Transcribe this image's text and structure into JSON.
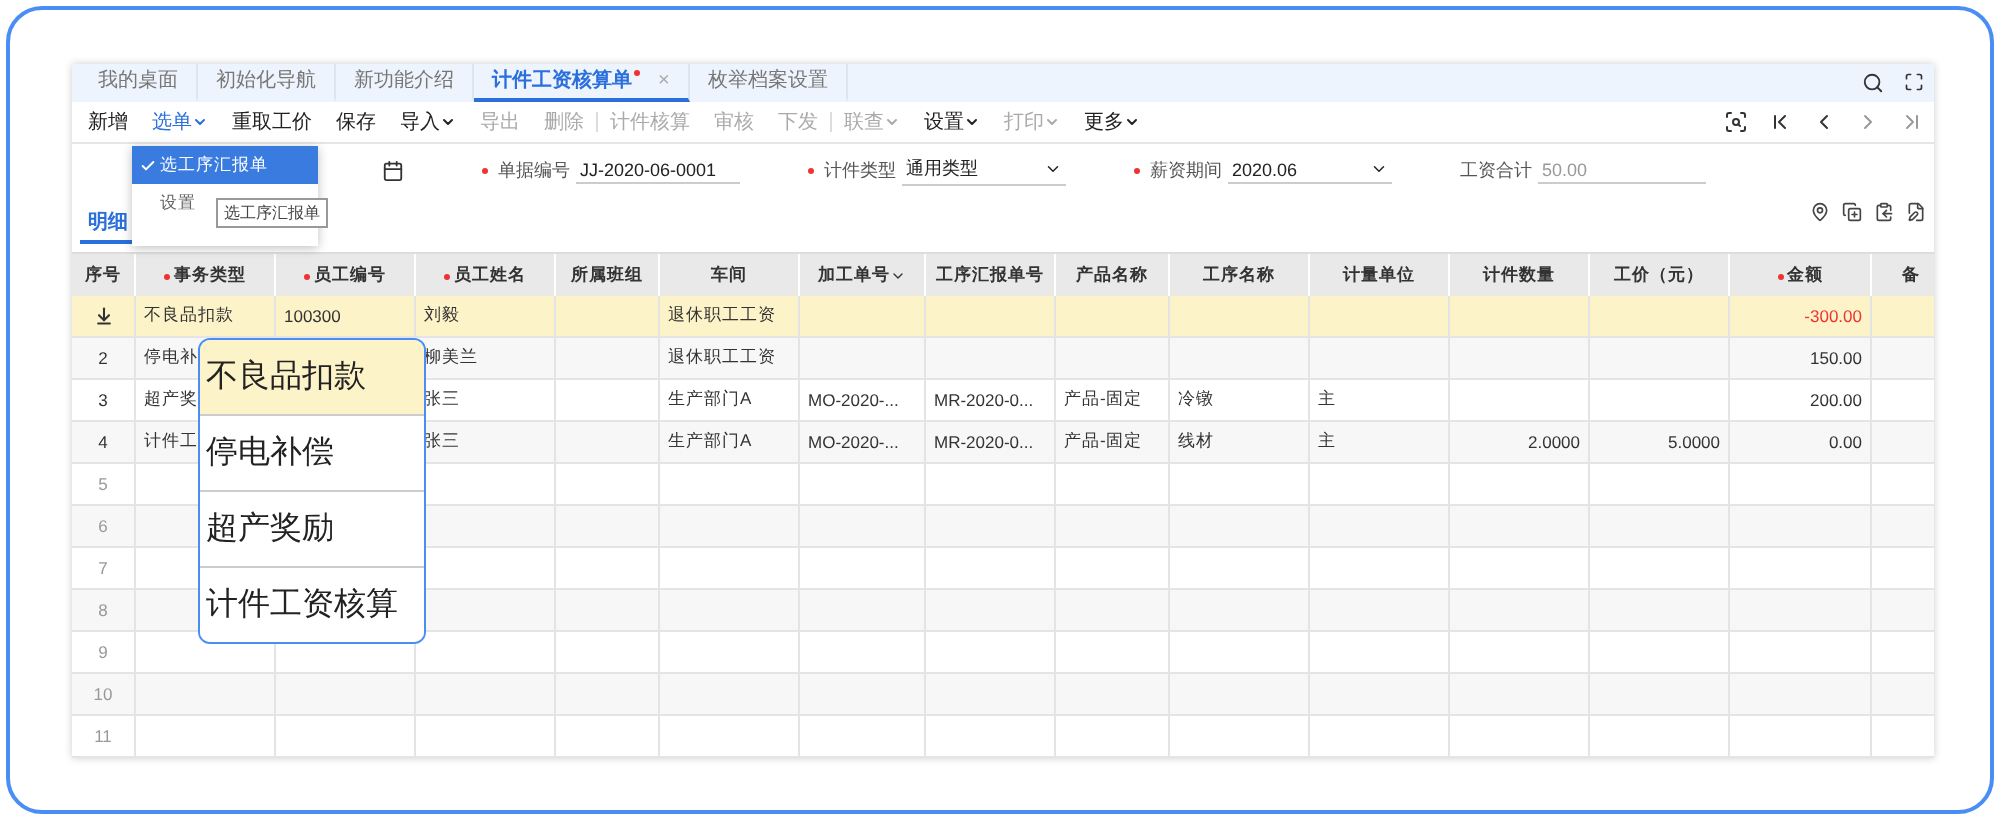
{
  "tabs": [
    {
      "label": "我的桌面",
      "selected": false,
      "unsaved": false
    },
    {
      "label": "初始化导航",
      "selected": false,
      "unsaved": false
    },
    {
      "label": "新功能介绍",
      "selected": false,
      "unsaved": false
    },
    {
      "label": "计件工资核算单",
      "selected": true,
      "unsaved": true,
      "close": "×"
    },
    {
      "label": "枚举档案设置",
      "selected": false,
      "unsaved": false
    }
  ],
  "toolbar": [
    {
      "label": "新增",
      "disabled": false,
      "dropdown": false
    },
    {
      "label": "选单",
      "disabled": false,
      "dropdown": true,
      "active": true
    },
    {
      "label": "重取工价",
      "disabled": false,
      "dropdown": false
    },
    {
      "label": "保存",
      "disabled": false,
      "dropdown": false
    },
    {
      "label": "导入",
      "disabled": false,
      "dropdown": true
    },
    {
      "label": "导出",
      "disabled": true,
      "dropdown": false
    },
    {
      "label": "删除",
      "disabled": true,
      "dropdown": false
    },
    {
      "label": "计件核算",
      "disabled": true,
      "dropdown": false,
      "divider_before": true
    },
    {
      "label": "审核",
      "disabled": true,
      "dropdown": false
    },
    {
      "label": "下发",
      "disabled": true,
      "dropdown": false
    },
    {
      "label": "联查",
      "disabled": true,
      "dropdown": true,
      "divider_before": true
    },
    {
      "label": "设置",
      "disabled": false,
      "dropdown": true
    },
    {
      "label": "打印",
      "disabled": true,
      "dropdown": true
    },
    {
      "label": "更多",
      "disabled": false,
      "dropdown": true
    }
  ],
  "select_menu": {
    "items": [
      {
        "label": "选工序汇报单",
        "checked": true
      },
      {
        "label": "设置",
        "checked": false
      }
    ],
    "tooltip": "选工序汇报单"
  },
  "form": [
    {
      "kind": "date"
    },
    {
      "kind": "text",
      "label": "单据编号",
      "required": true,
      "value": "JJ-2020-06-0001"
    },
    {
      "kind": "select",
      "label": "计件类型",
      "required": true,
      "value": "通用类型"
    },
    {
      "kind": "select",
      "label": "薪资期间",
      "required": true,
      "value": "2020.06"
    },
    {
      "kind": "readonly",
      "label": "工资合计",
      "value": "50.00"
    }
  ],
  "detail_tab": {
    "label": "明细",
    "selected": true
  },
  "table": {
    "columns": [
      {
        "label": "序号",
        "required": false
      },
      {
        "label": "事务类型",
        "required": true
      },
      {
        "label": "员工编号",
        "required": true
      },
      {
        "label": "员工姓名",
        "required": true
      },
      {
        "label": "所属班组",
        "required": false
      },
      {
        "label": "车间",
        "required": false
      },
      {
        "label": "加工单号",
        "required": false,
        "sortable": true
      },
      {
        "label": "工序汇报单号",
        "required": false
      },
      {
        "label": "产品名称",
        "required": false
      },
      {
        "label": "工序名称",
        "required": false
      },
      {
        "label": "计量单位",
        "required": false
      },
      {
        "label": "计件数量",
        "required": false
      },
      {
        "label": "工价（元）",
        "required": false
      },
      {
        "label": "金额",
        "required": true
      },
      {
        "label": "备",
        "required": false
      }
    ],
    "rows": [
      {
        "selected": true,
        "negative": true,
        "cells": [
          "不良品扣款",
          "100300",
          "刘毅",
          "",
          "退休职工工资",
          "",
          "",
          "",
          "",
          "",
          "",
          "",
          "-300.00",
          ""
        ]
      },
      {
        "no": "2",
        "selected": false,
        "negative": false,
        "cells": [
          "停电补",
          "",
          "柳美兰",
          "",
          "退休职工工资",
          "",
          "",
          "",
          "",
          "",
          "",
          "",
          "150.00",
          ""
        ]
      },
      {
        "no": "3",
        "selected": false,
        "negative": false,
        "cells": [
          "超产奖",
          "",
          "张三",
          "",
          "生产部门A",
          "MO-2020-...",
          "MR-2020-0...",
          "产品-固定",
          "冷镦",
          "主",
          "",
          "",
          "200.00",
          ""
        ]
      },
      {
        "no": "4",
        "selected": false,
        "negative": false,
        "cells": [
          "计件工",
          "",
          "张三",
          "",
          "生产部门A",
          "MO-2020-...",
          "MR-2020-0...",
          "产品-固定",
          "线材",
          "主",
          "2.0000",
          "5.0000",
          "0.00",
          ""
        ]
      },
      {
        "no": "5",
        "selected": false,
        "negative": false
      },
      {
        "no": "6",
        "selected": false,
        "negative": false
      },
      {
        "no": "7",
        "selected": false,
        "negative": false
      },
      {
        "no": "8",
        "selected": false,
        "negative": false
      },
      {
        "no": "9",
        "selected": false,
        "negative": false
      },
      {
        "no": "10",
        "selected": false,
        "negative": false
      },
      {
        "no": "11",
        "selected": false,
        "negative": false
      }
    ]
  },
  "callout": [
    {
      "label": "不良品扣款",
      "selected": true
    },
    {
      "label": "停电补偿",
      "selected": false
    },
    {
      "label": "超产奖励",
      "selected": false
    },
    {
      "label": "计件工资核算",
      "selected": false
    }
  ]
}
